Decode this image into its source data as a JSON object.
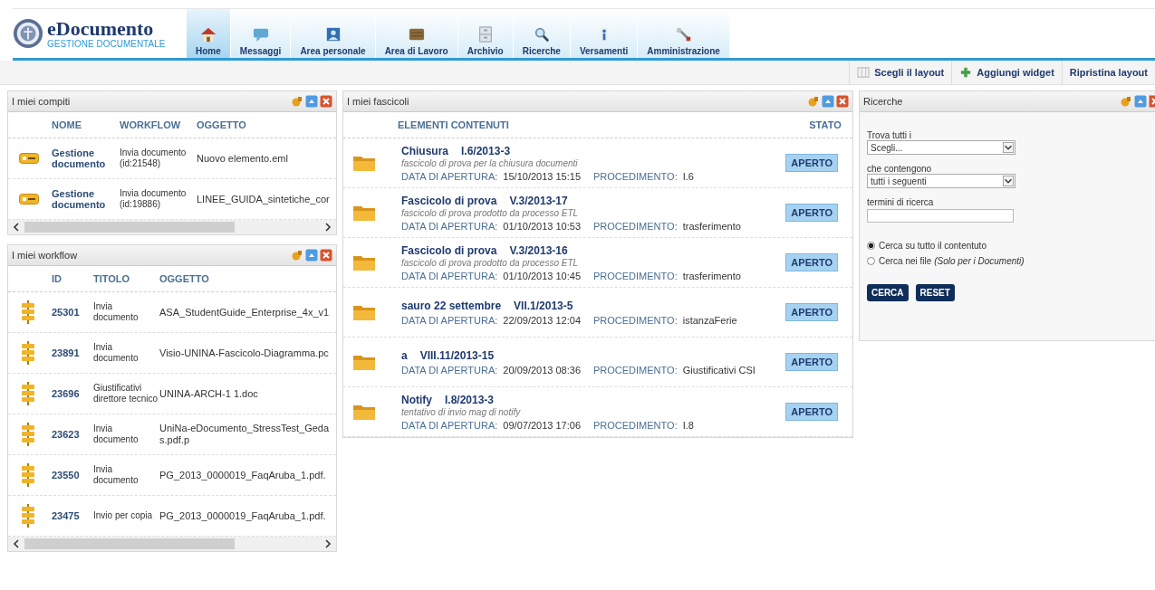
{
  "app": {
    "name": "eDocumento",
    "subtitle": "GESTIONE DOCUMENTALE"
  },
  "nav": [
    {
      "label": "Home",
      "selected": true
    },
    {
      "label": "Messaggi",
      "selected": false
    },
    {
      "label": "Area personale",
      "selected": false
    },
    {
      "label": "Area di Lavoro",
      "selected": false
    },
    {
      "label": "Archivio",
      "selected": false
    },
    {
      "label": "Ricerche",
      "selected": false
    },
    {
      "label": "Versamenti",
      "selected": false
    },
    {
      "label": "Amministrazione",
      "selected": false
    }
  ],
  "toolbar": [
    {
      "label": "Scegli il layout"
    },
    {
      "label": "Aggiungi widget"
    },
    {
      "label": "Ripristina layout"
    }
  ],
  "tasks": {
    "title": "I miei compiti",
    "columns": [
      "NOME",
      "WORKFLOW",
      "OGGETTO"
    ],
    "rows": [
      {
        "name": "Gestione documento",
        "workflow": "Invia documento (id:21548)",
        "object": "Nuovo elemento.eml"
      },
      {
        "name": "Gestione documento",
        "workflow": "Invia documento (id:19886)",
        "object": "LINEE_GUIDA_sintetiche_cor"
      }
    ]
  },
  "workflows": {
    "title": "I miei workflow",
    "columns": [
      "ID",
      "TITOLO",
      "OGGETTO"
    ],
    "rows": [
      {
        "id": "25301",
        "title": "Invia documento",
        "object": "ASA_StudentGuide_Enterprise_4x_v1"
      },
      {
        "id": "23891",
        "title": "Invia documento",
        "object": "Visio-UNINA-Fascicolo-Diagramma.pc"
      },
      {
        "id": "23696",
        "title": "Giustificativi direttore tecnico",
        "object": "UNINA-ARCH-1 1.doc"
      },
      {
        "id": "23623",
        "title": "Invia documento",
        "object": "UniNa-eDocumento_StressTest_Gedas.pdf.p"
      },
      {
        "id": "23550",
        "title": "Invia documento",
        "object": "PG_2013_0000019_FaqAruba_1.pdf."
      },
      {
        "id": "23475",
        "title": "Invio per copia",
        "object": "PG_2013_0000019_FaqAruba_1.pdf."
      }
    ]
  },
  "folders": {
    "title": "I miei fascicoli",
    "columns": [
      "ELEMENTI CONTENUTI",
      "STATO"
    ],
    "rows": [
      {
        "name": "Chiusura",
        "code": "I.6/2013-3",
        "description": "fascicolo di prova per la chiusura documenti",
        "date_label": "DATA DI APERTURA:",
        "date": "15/10/2013 15:15",
        "procedure_label": "PROCEDIMENTO:",
        "procedure": "I.6",
        "status": "APERTO"
      },
      {
        "name": "Fascicolo di prova",
        "code": "V.3/2013-17",
        "description": "fascicolo di prova prodotto da processo ETL",
        "date_label": "DATA DI APERTURA:",
        "date": "01/10/2013 10:53",
        "procedure_label": "PROCEDIMENTO:",
        "procedure": "trasferimento",
        "status": "APERTO"
      },
      {
        "name": "Fascicolo di prova",
        "code": "V.3/2013-16",
        "description": "fascicolo di prova prodotto da processo ETL",
        "date_label": "DATA DI APERTURA:",
        "date": "01/10/2013 10:45",
        "procedure_label": "PROCEDIMENTO:",
        "procedure": "trasferimento",
        "status": "APERTO"
      },
      {
        "name": "sauro 22 settembre",
        "code": "VII.1/2013-5",
        "date_label": "DATA DI APERTURA:",
        "date": "22/09/2013 12:04",
        "procedure_label": "PROCEDIMENTO:",
        "procedure": "istanzaFerie",
        "status": "APERTO"
      },
      {
        "name": "a",
        "code": "VIII.11/2013-15",
        "date_label": "DATA DI APERTURA:",
        "date": "20/09/2013 08:36",
        "procedure_label": "PROCEDIMENTO:",
        "procedure": "Giustificativi CSI",
        "status": "APERTO"
      },
      {
        "name": "Notify",
        "code": "I.8/2013-3",
        "description": "tentativo di invio mag di notify",
        "date_label": "DATA DI APERTURA:",
        "date": "09/07/2013 17:06",
        "procedure_label": "PROCEDIMENTO:",
        "procedure": "I.8",
        "status": "APERTO"
      }
    ]
  },
  "search": {
    "title": "Ricerche",
    "find_label": "Trova tutti i",
    "find_value": "Scegli...",
    "contain_label": "che contengono",
    "contain_value": "tutti i seguenti",
    "terms_label": "termini di ricerca",
    "options": [
      {
        "label": "Cerca su tutto il contentuto",
        "selected": true
      },
      {
        "label": "Cerca nei file *(Solo per i Documenti)*",
        "selected": false
      }
    ],
    "buttons": [
      "CERCA",
      "RESET"
    ]
  }
}
